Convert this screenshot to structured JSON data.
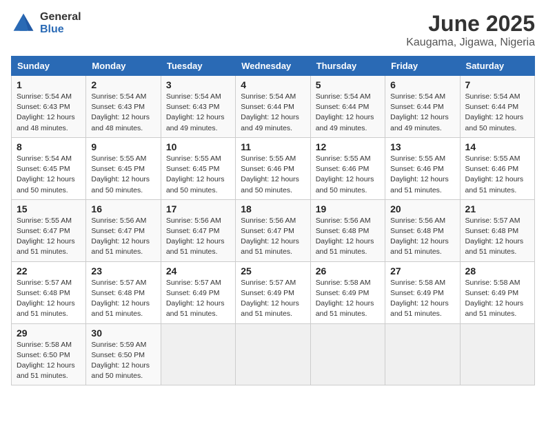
{
  "logo": {
    "general": "General",
    "blue": "Blue"
  },
  "title": "June 2025",
  "subtitle": "Kaugama, Jigawa, Nigeria",
  "days_of_week": [
    "Sunday",
    "Monday",
    "Tuesday",
    "Wednesday",
    "Thursday",
    "Friday",
    "Saturday"
  ],
  "weeks": [
    [
      {
        "day": "1",
        "sunrise": "5:54 AM",
        "sunset": "6:43 PM",
        "daylight": "12 hours and 48 minutes."
      },
      {
        "day": "2",
        "sunrise": "5:54 AM",
        "sunset": "6:43 PM",
        "daylight": "12 hours and 48 minutes."
      },
      {
        "day": "3",
        "sunrise": "5:54 AM",
        "sunset": "6:43 PM",
        "daylight": "12 hours and 49 minutes."
      },
      {
        "day": "4",
        "sunrise": "5:54 AM",
        "sunset": "6:44 PM",
        "daylight": "12 hours and 49 minutes."
      },
      {
        "day": "5",
        "sunrise": "5:54 AM",
        "sunset": "6:44 PM",
        "daylight": "12 hours and 49 minutes."
      },
      {
        "day": "6",
        "sunrise": "5:54 AM",
        "sunset": "6:44 PM",
        "daylight": "12 hours and 49 minutes."
      },
      {
        "day": "7",
        "sunrise": "5:54 AM",
        "sunset": "6:44 PM",
        "daylight": "12 hours and 50 minutes."
      }
    ],
    [
      {
        "day": "8",
        "sunrise": "5:54 AM",
        "sunset": "6:45 PM",
        "daylight": "12 hours and 50 minutes."
      },
      {
        "day": "9",
        "sunrise": "5:55 AM",
        "sunset": "6:45 PM",
        "daylight": "12 hours and 50 minutes."
      },
      {
        "day": "10",
        "sunrise": "5:55 AM",
        "sunset": "6:45 PM",
        "daylight": "12 hours and 50 minutes."
      },
      {
        "day": "11",
        "sunrise": "5:55 AM",
        "sunset": "6:46 PM",
        "daylight": "12 hours and 50 minutes."
      },
      {
        "day": "12",
        "sunrise": "5:55 AM",
        "sunset": "6:46 PM",
        "daylight": "12 hours and 50 minutes."
      },
      {
        "day": "13",
        "sunrise": "5:55 AM",
        "sunset": "6:46 PM",
        "daylight": "12 hours and 51 minutes."
      },
      {
        "day": "14",
        "sunrise": "5:55 AM",
        "sunset": "6:46 PM",
        "daylight": "12 hours and 51 minutes."
      }
    ],
    [
      {
        "day": "15",
        "sunrise": "5:55 AM",
        "sunset": "6:47 PM",
        "daylight": "12 hours and 51 minutes."
      },
      {
        "day": "16",
        "sunrise": "5:56 AM",
        "sunset": "6:47 PM",
        "daylight": "12 hours and 51 minutes."
      },
      {
        "day": "17",
        "sunrise": "5:56 AM",
        "sunset": "6:47 PM",
        "daylight": "12 hours and 51 minutes."
      },
      {
        "day": "18",
        "sunrise": "5:56 AM",
        "sunset": "6:47 PM",
        "daylight": "12 hours and 51 minutes."
      },
      {
        "day": "19",
        "sunrise": "5:56 AM",
        "sunset": "6:48 PM",
        "daylight": "12 hours and 51 minutes."
      },
      {
        "day": "20",
        "sunrise": "5:56 AM",
        "sunset": "6:48 PM",
        "daylight": "12 hours and 51 minutes."
      },
      {
        "day": "21",
        "sunrise": "5:57 AM",
        "sunset": "6:48 PM",
        "daylight": "12 hours and 51 minutes."
      }
    ],
    [
      {
        "day": "22",
        "sunrise": "5:57 AM",
        "sunset": "6:48 PM",
        "daylight": "12 hours and 51 minutes."
      },
      {
        "day": "23",
        "sunrise": "5:57 AM",
        "sunset": "6:48 PM",
        "daylight": "12 hours and 51 minutes."
      },
      {
        "day": "24",
        "sunrise": "5:57 AM",
        "sunset": "6:49 PM",
        "daylight": "12 hours and 51 minutes."
      },
      {
        "day": "25",
        "sunrise": "5:57 AM",
        "sunset": "6:49 PM",
        "daylight": "12 hours and 51 minutes."
      },
      {
        "day": "26",
        "sunrise": "5:58 AM",
        "sunset": "6:49 PM",
        "daylight": "12 hours and 51 minutes."
      },
      {
        "day": "27",
        "sunrise": "5:58 AM",
        "sunset": "6:49 PM",
        "daylight": "12 hours and 51 minutes."
      },
      {
        "day": "28",
        "sunrise": "5:58 AM",
        "sunset": "6:49 PM",
        "daylight": "12 hours and 51 minutes."
      }
    ],
    [
      {
        "day": "29",
        "sunrise": "5:58 AM",
        "sunset": "6:50 PM",
        "daylight": "12 hours and 51 minutes."
      },
      {
        "day": "30",
        "sunrise": "5:59 AM",
        "sunset": "6:50 PM",
        "daylight": "12 hours and 50 minutes."
      },
      null,
      null,
      null,
      null,
      null
    ]
  ],
  "labels": {
    "sunrise_prefix": "Sunrise: ",
    "sunset_prefix": "Sunset: ",
    "daylight_prefix": "Daylight: "
  }
}
